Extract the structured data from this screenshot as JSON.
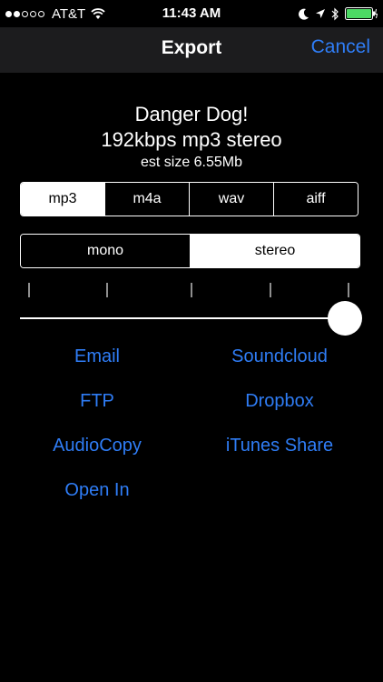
{
  "status_bar": {
    "carrier": "AT&T",
    "time": "11:43 AM",
    "signal_bars_filled": 2,
    "signal_bars_total": 5,
    "icons": [
      "wifi-icon",
      "moon-icon",
      "location-arrow-icon",
      "bluetooth-icon",
      "battery-icon"
    ],
    "battery_color": "#4cd964"
  },
  "nav": {
    "title": "Export",
    "cancel_label": "Cancel"
  },
  "info": {
    "name": "Danger Dog!",
    "format_line": "192kbps mp3 stereo",
    "size_line": "est size 6.55Mb"
  },
  "format_options": {
    "items": [
      "mp3",
      "m4a",
      "wav",
      "aiff"
    ],
    "selected": "mp3"
  },
  "channel_options": {
    "items": [
      "mono",
      "stereo"
    ],
    "selected": "stereo"
  },
  "quality_slider": {
    "tick_count": 5,
    "value_fraction": 1.0
  },
  "export_options": {
    "email": "Email",
    "soundcloud": "Soundcloud",
    "ftp": "FTP",
    "dropbox": "Dropbox",
    "audiocopy": "AudioCopy",
    "itunes_share": "iTunes Share",
    "open_in": "Open In"
  },
  "colors": {
    "accent": "#2f7df6",
    "background": "#000000",
    "nav_background": "#1c1c1e"
  }
}
